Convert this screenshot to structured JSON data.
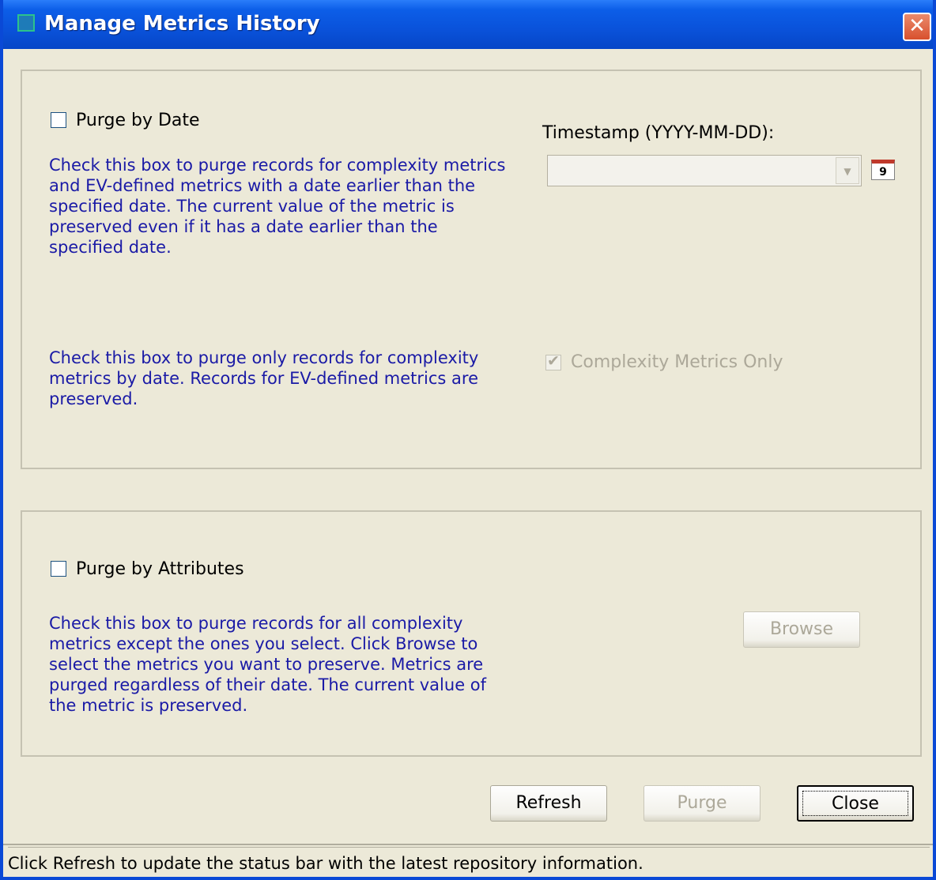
{
  "window": {
    "title": "Manage Metrics History",
    "close_glyph": "✕"
  },
  "date_group": {
    "checkbox_label": "Purge by Date",
    "description": "Check this box to purge records for complexity metrics and EV-defined metrics with a date earlier than the specified date. The current value of the metric is preserved even if it has a date earlier than the specified date.",
    "timestamp_label": "Timestamp (YYYY-MM-DD):",
    "timestamp_value": "",
    "calendar_icon_text": "9",
    "complexity_description": "Check this box to purge only records for complexity metrics by date. Records for EV-defined metrics are preserved.",
    "complexity_label": "Complexity Metrics Only",
    "complexity_checked": true
  },
  "attributes_group": {
    "checkbox_label": "Purge by Attributes",
    "description": "Check this box to purge records for all complexity metrics except the ones you select. Click Browse to select the metrics you want to preserve. Metrics are purged regardless of their date. The current value of the metric is preserved.",
    "browse_label": "Browse"
  },
  "buttons": {
    "refresh": "Refresh",
    "purge": "Purge",
    "close": "Close"
  },
  "status": "Click Refresh to update the status bar with the latest repository information."
}
